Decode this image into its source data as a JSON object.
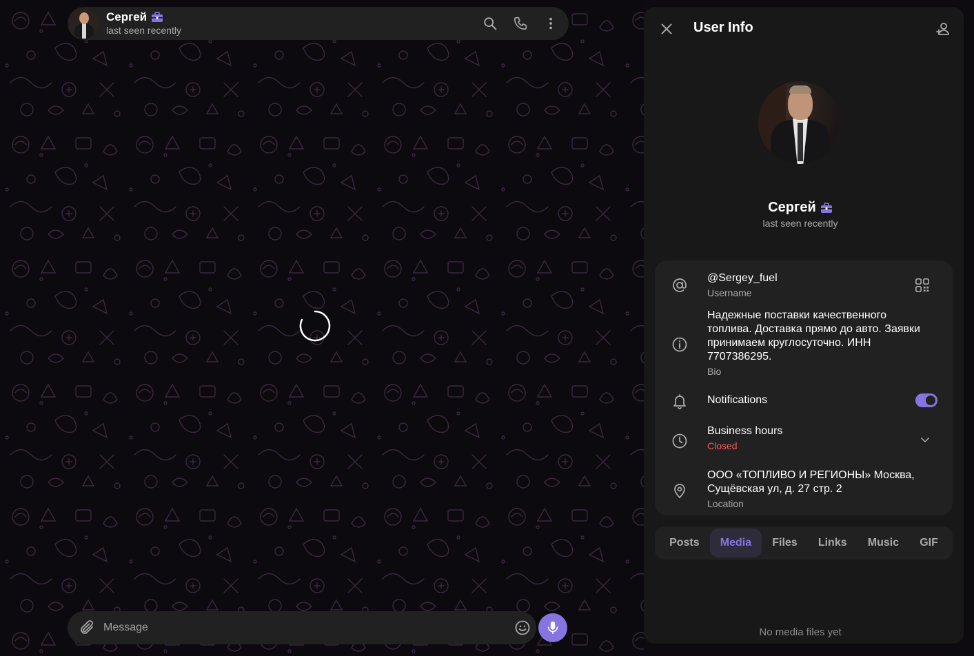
{
  "colors": {
    "accent": "#8774e1",
    "panel_bg": "#181818",
    "card_bg": "#212121",
    "closed_red": "#ff595a",
    "pattern_stroke": "#3a2740"
  },
  "chat_header": {
    "name": "Сергей",
    "status": "last seen recently",
    "badge_icon": "business-briefcase-icon",
    "actions": [
      "search-icon",
      "phone-icon",
      "more-vertical-icon"
    ]
  },
  "composer": {
    "placeholder": "Message",
    "attach_icon": "paperclip-icon",
    "emoji_icon": "smile-icon",
    "send_icon": "microphone-icon"
  },
  "user_info": {
    "title": "User Info",
    "close_icon": "close-icon",
    "add_contact_icon": "add-contact-icon",
    "name": "Сергей",
    "status": "last seen recently",
    "username": {
      "value": "@Sergey_fuel",
      "label": "Username"
    },
    "bio": {
      "lines": [
        "Надежные поставки качественного",
        "топлива. Доставка прямо до авто. Заявки",
        "принимаем круглосуточно. ИНН",
        "7707386295."
      ],
      "label": "Bio"
    },
    "notifications": {
      "label": "Notifications",
      "enabled": true
    },
    "business_hours": {
      "label": "Business hours",
      "state": "Closed"
    },
    "location": {
      "lines": [
        "ООО «ТОПЛИВО И РЕГИОНЫ» Москва,",
        "Сущёвская ул, д. 27 стр. 2"
      ],
      "label": "Location"
    },
    "tabs": [
      "Posts",
      "Media",
      "Files",
      "Links",
      "Music",
      "GIF"
    ],
    "active_tab": "Media",
    "empty_text": "No media files yet"
  }
}
